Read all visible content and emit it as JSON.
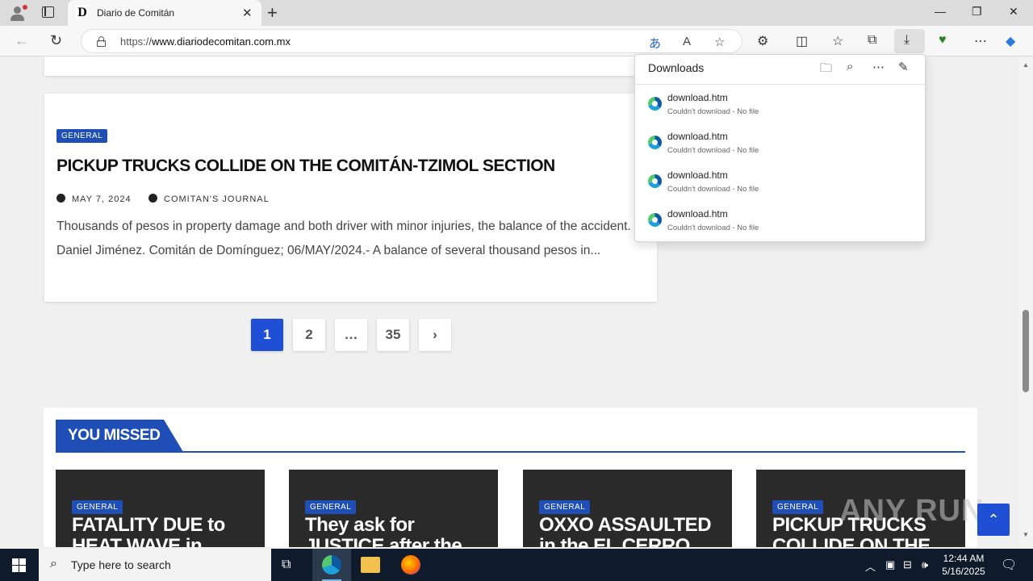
{
  "browser": {
    "tab_title": "Diario de Comitán",
    "tab_favicon": "D",
    "url_prefix": "https://",
    "url_host": "www.diariodecomitan.com.mx"
  },
  "downloads": {
    "title": "Downloads",
    "items": [
      {
        "name": "download.htm",
        "status": "Couldn't download - No file"
      },
      {
        "name": "download.htm",
        "status": "Couldn't download - No file"
      },
      {
        "name": "download.htm",
        "status": "Couldn't download - No file"
      },
      {
        "name": "download.htm",
        "status": "Couldn't download - No file"
      }
    ]
  },
  "article": {
    "category": "GENERAL",
    "title": "PICKUP TRUCKS COLLIDE ON THE COMITÁN-TZIMOL SECTION",
    "date": "MAY 7, 2024",
    "author": "COMITAN'S JOURNAL",
    "excerpt": "Thousands of pesos in property damage and both driver with minor injuries, the balance of the accident. Daniel Jiménez. Comitán de Domínguez; 06/MAY/2024.- A balance of several thousand pesos in..."
  },
  "pagination": {
    "pages": [
      "1",
      "2",
      "…",
      "35"
    ],
    "active": "1",
    "next": "›"
  },
  "you_missed": {
    "heading": "YOU MISSED",
    "tiles": [
      {
        "category": "GENERAL",
        "title": "FATALITY DUE to HEAT WAVE in"
      },
      {
        "category": "GENERAL",
        "title": "They ask for JUSTICE after the"
      },
      {
        "category": "GENERAL",
        "title": "OXXO ASSAULTED in the EL CERRO"
      },
      {
        "category": "GENERAL",
        "title": "PICKUP TRUCKS COLLIDE ON THE"
      }
    ]
  },
  "watermark": "ANY RUN",
  "taskbar": {
    "search_placeholder": "Type here to search",
    "time": "12:44 AM",
    "date": "5/16/2025"
  },
  "colors": {
    "accent": "#1f4fb6",
    "page_button_active": "#1f4fd4",
    "taskbar": "#0f1a2a"
  }
}
